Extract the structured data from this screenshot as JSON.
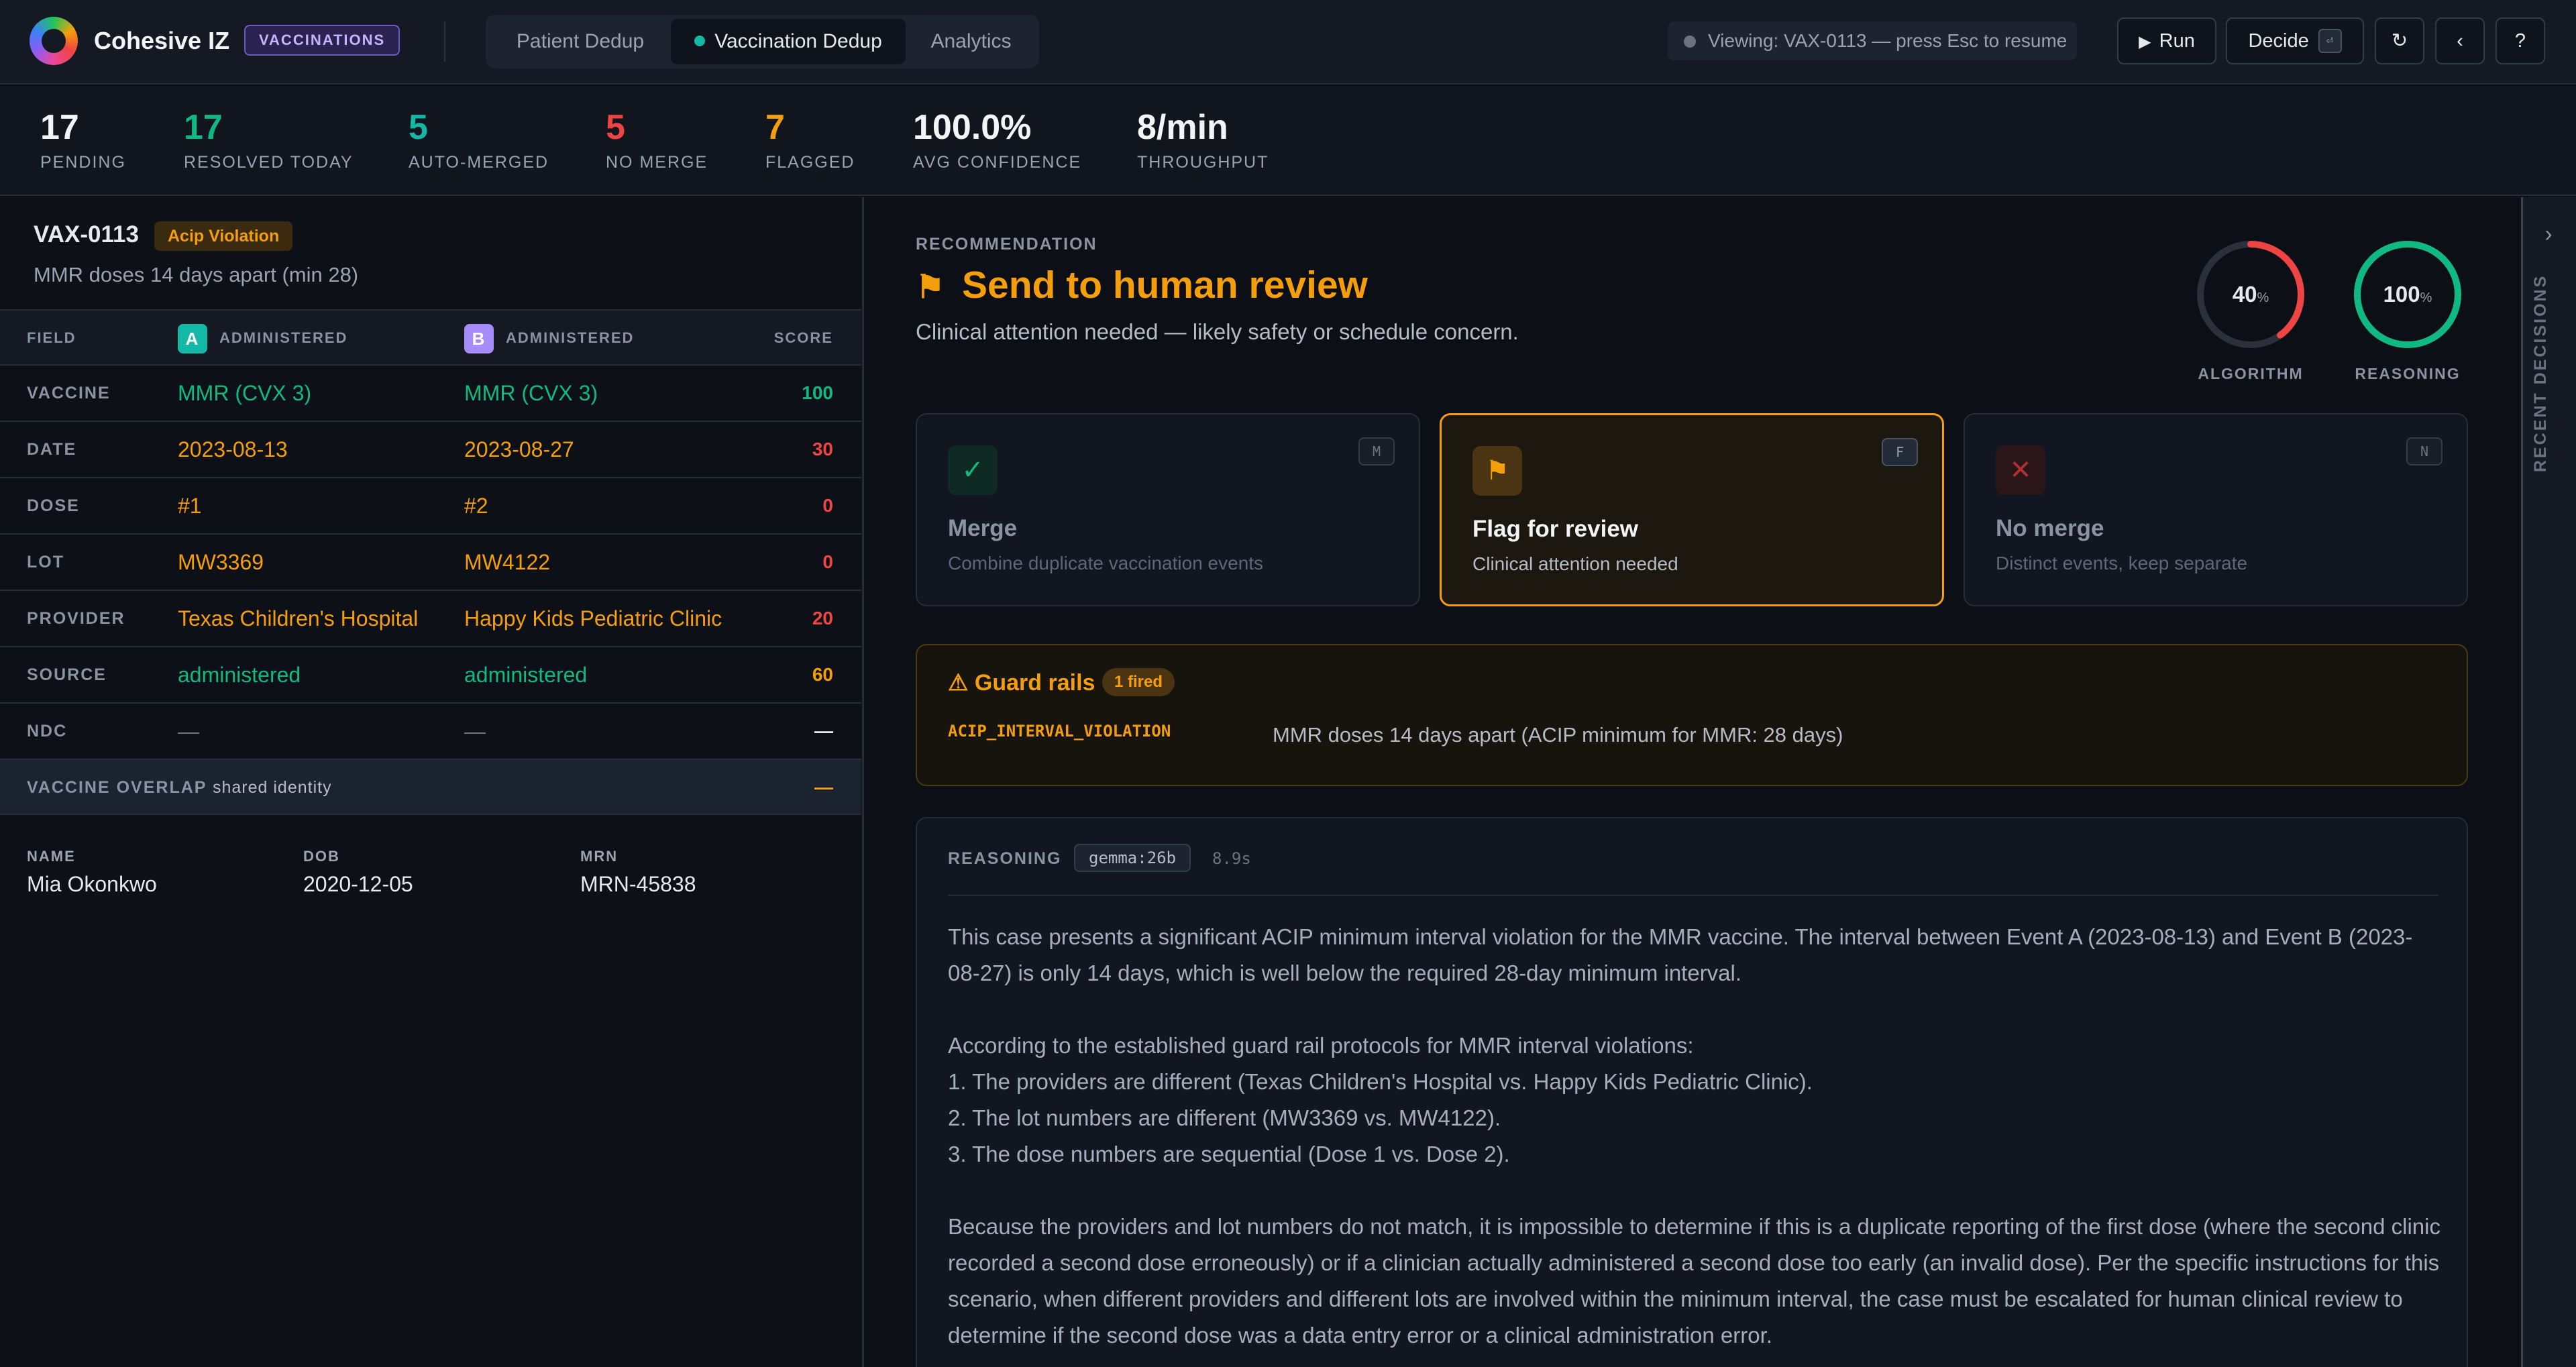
{
  "header": {
    "app_name": "Cohesive IZ",
    "badge": "VACCINATIONS",
    "tabs": [
      {
        "label": "Patient Dedup"
      },
      {
        "label": "Vaccination Dedup"
      },
      {
        "label": "Analytics"
      }
    ],
    "viewing": "Viewing: VAX-0113 — press Esc to resume",
    "run_label": "Run",
    "decide_label": "Decide",
    "decide_key": "⏎",
    "refresh_icon": "↻",
    "collapse_icon": "‹",
    "help_label": "?"
  },
  "stats": [
    {
      "value": "17",
      "label": "PENDING",
      "color": "#f3f4f6"
    },
    {
      "value": "17",
      "label": "RESOLVED TODAY",
      "color": "#10b981"
    },
    {
      "value": "5",
      "label": "AUTO-MERGED",
      "color": "#14b8a6"
    },
    {
      "value": "5",
      "label": "NO MERGE",
      "color": "#ef4444"
    },
    {
      "value": "7",
      "label": "FLAGGED",
      "color": "#f59e0b"
    },
    {
      "value": "100.0%",
      "label": "AVG CONFIDENCE",
      "color": "#f3f4f6"
    },
    {
      "value": "8/min",
      "label": "THROUGHPUT",
      "color": "#f3f4f6"
    }
  ],
  "case": {
    "id": "VAX-0113",
    "badge": "Acip Violation",
    "subtitle": "MMR doses 14 days apart (min 28)"
  },
  "table": {
    "headers": {
      "field": "FIELD",
      "a_chip": "A",
      "a": "ADMINISTERED",
      "b_chip": "B",
      "b": "ADMINISTERED",
      "score": "SCORE"
    },
    "rows": [
      {
        "field": "VACCINE",
        "a": "MMR (CVX 3)",
        "b": "MMR (CVX 3)",
        "score": "100"
      },
      {
        "field": "DATE",
        "a": "2023-08-13",
        "b": "2023-08-27",
        "score": "30"
      },
      {
        "field": "DOSE",
        "a": "#1",
        "b": "#2",
        "score": "0"
      },
      {
        "field": "LOT",
        "a": "MW3369",
        "b": "MW4122",
        "score": "0"
      },
      {
        "field": "PROVIDER",
        "a": "Texas Children's Hospital",
        "b": "Happy Kids Pediatric Clinic",
        "score": "20"
      },
      {
        "field": "SOURCE",
        "a": "administered",
        "b": "administered",
        "score": "60"
      },
      {
        "field": "NDC",
        "a": "—",
        "b": "—",
        "score": "—"
      }
    ],
    "overlap_label": "VACCINE OVERLAP",
    "overlap_note": "shared identity",
    "overlap_score": "—"
  },
  "patient": {
    "name_label": "NAME",
    "name": "Mia Okonkwo",
    "dob_label": "DOB",
    "dob": "2020-12-05",
    "mrn_label": "MRN",
    "mrn": "MRN-45838"
  },
  "recommendation": {
    "label": "RECOMMENDATION",
    "icon": "⚑",
    "title": "Send to human review",
    "subtitle": "Clinical attention needed — likely safety or schedule concern.",
    "gauges": [
      {
        "value": "40",
        "unit": "%",
        "label": "ALGORITHM",
        "percent": 40,
        "color": "#ef4444"
      },
      {
        "value": "100",
        "unit": "%",
        "label": "REASONING",
        "percent": 100,
        "color": "#10b981"
      }
    ]
  },
  "actions": [
    {
      "icon": "✓",
      "key": "M",
      "title": "Merge",
      "desc": "Combine duplicate vaccination events"
    },
    {
      "icon": "⚑",
      "key": "F",
      "title": "Flag for review",
      "desc": "Clinical attention needed"
    },
    {
      "icon": "✕",
      "key": "N",
      "title": "No merge",
      "desc": "Distinct events, keep separate"
    }
  ],
  "guard": {
    "title": "⚠ Guard rails",
    "badge": "1 fired",
    "rule": "ACIP_INTERVAL_VIOLATION",
    "detail": "MMR doses 14 days apart (ACIP minimum for MMR: 28 days)"
  },
  "reasoning": {
    "label": "REASONING",
    "model": "gemma:26b",
    "time": "8.9s",
    "p1": "This case presents a significant ACIP minimum interval violation for the MMR vaccine. The interval between Event A (2023-08-13) and Event B (2023-08-27) is only 14 days, which is well below the required 28-day minimum interval.",
    "p2": "According to the established guard rail protocols for MMR interval violations:",
    "p2_items": [
      "1. The providers are different (Texas Children's Hospital vs. Happy Kids Pediatric Clinic).",
      "2. The lot numbers are different (MW3369 vs. MW4122).",
      "3. The dose numbers are sequential (Dose 1 vs. Dose 2)."
    ],
    "p3": "Because the providers and lot numbers do not match, it is impossible to determine if this is a duplicate reporting of the first dose (where the second clinic recorded a second dose erroneously) or if a clinician actually administered a second dose too early (an invalid dose). Per the specific instructions for this scenario, when different providers and different lots are involved within the minimum interval, the case must be escalated for human clinical review to determine if the second dose was a data entry error or a clinical administration error."
  },
  "sidebar": {
    "label": "RECENT DECISIONS",
    "chevron": "›"
  }
}
